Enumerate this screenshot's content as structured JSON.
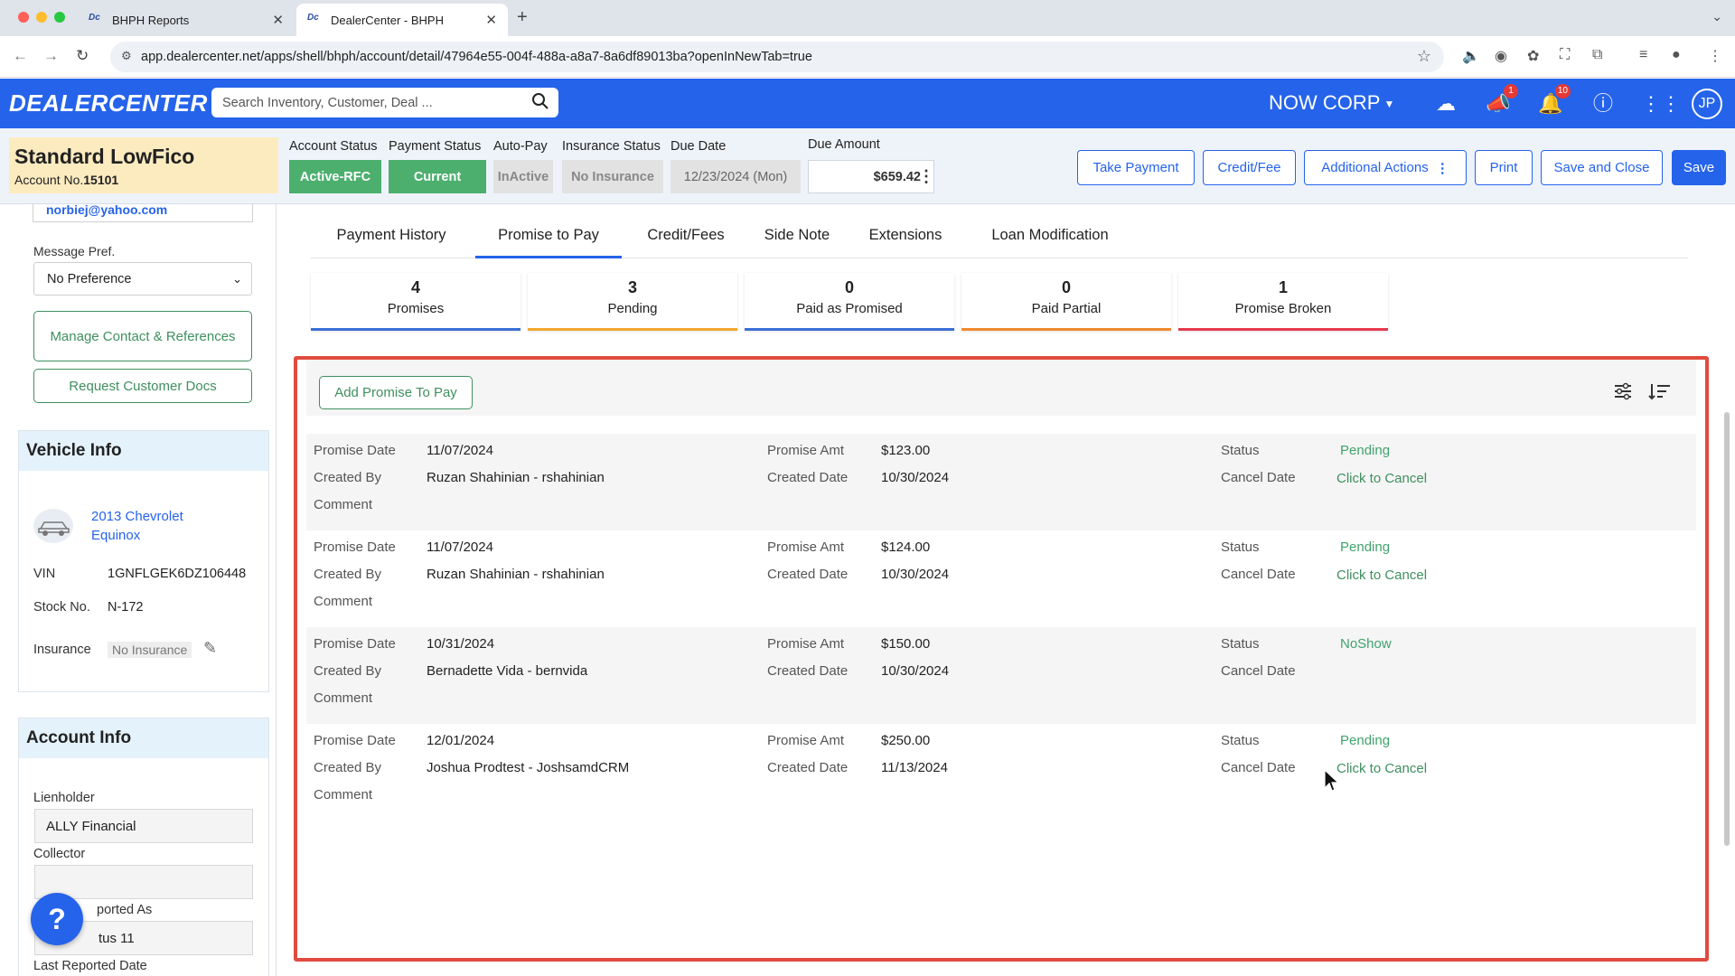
{
  "browser": {
    "tabs": [
      {
        "label": "BHPH Reports",
        "active": false
      },
      {
        "label": "DealerCenter - BHPH",
        "active": true
      }
    ],
    "url": "app.dealercenter.net/apps/shell/bhph/account/detail/47964e55-004f-488a-a8a7-8a6df89013ba?openInNewTab=true"
  },
  "header": {
    "logo": "DEALERCENTER",
    "search_placeholder": "Search Inventory, Customer, Deal ...",
    "company": "NOW CORP",
    "announcements_badge": "1",
    "notifications_badge": "10",
    "user_initials": "JP"
  },
  "account": {
    "customer_name": "Standard LowFico",
    "account_no_label": "Account No.",
    "account_no": "15101",
    "account_status_label": "Account Status",
    "account_status": "Active-RFC",
    "payment_status_label": "Payment Status",
    "payment_status": "Current",
    "autopay_label": "Auto-Pay",
    "autopay": "InActive",
    "insurance_status_label": "Insurance Status",
    "insurance_status": "No Insurance",
    "due_date_label": "Due Date",
    "due_date": "12/23/2024 (Mon)",
    "due_amount_label": "Due Amount",
    "due_amount": "$659.42",
    "actions": {
      "take_payment": "Take Payment",
      "credit_fee": "Credit/Fee",
      "additional_actions": "Additional Actions",
      "print": "Print",
      "save_close": "Save and Close",
      "save": "Save"
    }
  },
  "sidebar": {
    "email": "norbiej@yahoo.com",
    "message_pref_label": "Message Pref.",
    "message_pref": "No Preference",
    "manage_contact_btn": "Manage Contact & References",
    "request_docs_btn": "Request Customer Docs",
    "vehicle": {
      "title": "Vehicle Info",
      "name_line1": "2013 Chevrolet",
      "name_line2": "Equinox",
      "vin_label": "VIN",
      "vin": "1GNFLGEK6DZ106448",
      "stock_label": "Stock No.",
      "stock": "N-172",
      "insurance_label": "Insurance",
      "insurance": "No Insurance"
    },
    "account_info": {
      "title": "Account Info",
      "lienholder_label": "Lienholder",
      "lienholder": "ALLY Financial",
      "collector_label": "Collector",
      "collector": "",
      "reported_as_label": "ported As",
      "reported_as": "tus 11",
      "last_reported_label": "Last Reported Date"
    },
    "help_fab": "?"
  },
  "main": {
    "tabs": [
      {
        "label": "Payment History"
      },
      {
        "label": "Promise to Pay"
      },
      {
        "label": "Credit/Fees"
      },
      {
        "label": "Side Note"
      },
      {
        "label": "Extensions"
      },
      {
        "label": "Loan Modification"
      }
    ],
    "summary": [
      {
        "count": "4",
        "label": "Promises",
        "color": "#3b6fd6"
      },
      {
        "count": "3",
        "label": "Pending",
        "color": "#f0a830"
      },
      {
        "count": "0",
        "label": "Paid as Promised",
        "color": "#3b6fd6"
      },
      {
        "count": "0",
        "label": "Paid Partial",
        "color": "#f08a30"
      },
      {
        "count": "1",
        "label": "Promise Broken",
        "color": "#e53950"
      }
    ],
    "add_promise_btn": "Add Promise To Pay",
    "labels": {
      "promise_date": "Promise Date",
      "created_by": "Created By",
      "comment": "Comment",
      "promise_amt": "Promise Amt",
      "created_date": "Created Date",
      "status": "Status",
      "cancel_date": "Cancel Date"
    },
    "promises": [
      {
        "promise_date": "11/07/2024",
        "created_by": "Ruzan Shahinian - rshahinian",
        "promise_amt": "$123.00",
        "created_date": "10/30/2024",
        "status": "Pending",
        "cancel": "Click to Cancel"
      },
      {
        "promise_date": "11/07/2024",
        "created_by": "Ruzan Shahinian - rshahinian",
        "promise_amt": "$124.00",
        "created_date": "10/30/2024",
        "status": "Pending",
        "cancel": "Click to Cancel"
      },
      {
        "promise_date": "10/31/2024",
        "created_by": "Bernadette Vida - bernvida",
        "promise_amt": "$150.00",
        "created_date": "10/30/2024",
        "status": "NoShow",
        "cancel": ""
      },
      {
        "promise_date": "12/01/2024",
        "created_by": "Joshua Prodtest - JoshsamdCRM",
        "promise_amt": "$250.00",
        "created_date": "11/13/2024",
        "status": "Pending",
        "cancel": "Click to Cancel"
      }
    ]
  }
}
